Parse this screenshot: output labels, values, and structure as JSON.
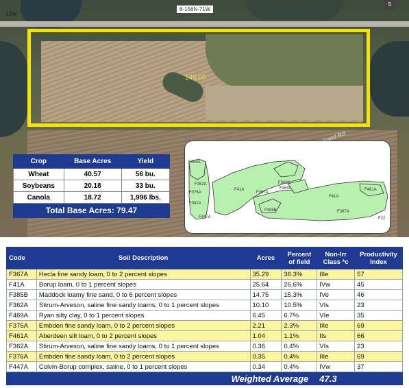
{
  "aerial": {
    "road_label": "6-156N-71W",
    "corner_label": "32W",
    "section_number": "5",
    "acre_label": "149.00",
    "side_road_label": "Sand Rd"
  },
  "crop_table": {
    "headers": [
      "Crop",
      "Base Acres",
      "Yield"
    ],
    "rows": [
      {
        "crop": "Wheat",
        "acres": "40.57",
        "yield": "56 bu."
      },
      {
        "crop": "Soybeans",
        "acres": "20.18",
        "yield": "33 bu."
      },
      {
        "crop": "Canola",
        "acres": "18.72",
        "yield": "1,996 lbs."
      }
    ],
    "total": "Total Base Acres: 79.47"
  },
  "soil_map": {
    "labels": [
      "F469A",
      "F362A",
      "F376A",
      "F362A",
      "F447A",
      "F41A",
      "F367A",
      "F362A",
      "F469A",
      "F385B",
      "F41A",
      "F461A",
      "F367A",
      "F22"
    ]
  },
  "soil_table": {
    "headers": {
      "code": "Code",
      "desc": "Soil Description",
      "acres": "Acres",
      "pct_line1": "Percent",
      "pct_line2": "of field",
      "class_line1": "Non-Irr",
      "class_line2": "Class *c",
      "prod_line1": "Productivity",
      "prod_line2": "Index"
    },
    "rows": [
      {
        "code": "F367A",
        "desc": "Hecla fine sandy loam, 0 to 2 percent slopes",
        "acres": "35.29",
        "pct": "36.3%",
        "class": "IIIe",
        "index": "57",
        "highlight": true
      },
      {
        "code": "F41A",
        "desc": "Borup loam, 0 to 1 percent slopes",
        "acres": "25.64",
        "pct": "26.6%",
        "class": "IVw",
        "index": "45",
        "highlight": false
      },
      {
        "code": "F385B",
        "desc": "Maddock loamy fine sand, 0 to 6 percent slopes",
        "acres": "14.75",
        "pct": "15.3%",
        "class": "IVe",
        "index": "46",
        "highlight": false
      },
      {
        "code": "F362A",
        "desc": "Stirum-Arveson, saline fine sandy loams, 0 to 1 percent slopes",
        "acres": "10.10",
        "pct": "10.5%",
        "class": "VIs",
        "index": "23",
        "highlight": false
      },
      {
        "code": "F469A",
        "desc": "Ryan silty clay, 0 to 1 percent slopes",
        "acres": "6.45",
        "pct": "6.7%",
        "class": "VIe",
        "index": "35",
        "highlight": false
      },
      {
        "code": "F376A",
        "desc": "Embden fine sandy loam, 0 to 2 percent slopes",
        "acres": "2.21",
        "pct": "2.3%",
        "class": "IIIe",
        "index": "69",
        "highlight": true
      },
      {
        "code": "F461A",
        "desc": "Aberdeen silt loam, 0 to 2 percent slopes",
        "acres": "1.04",
        "pct": "1.1%",
        "class": "IIs",
        "index": "66",
        "highlight": true
      },
      {
        "code": "F362A",
        "desc": "Stirum-Arveson, saline fine sandy loams, 0 to 1 percent slopes",
        "acres": "0.36",
        "pct": "0.4%",
        "class": "VIs",
        "index": "23",
        "highlight": false
      },
      {
        "code": "F376A",
        "desc": "Embden fine sandy loam, 0 to 2 percent slopes",
        "acres": "0.35",
        "pct": "0.4%",
        "class": "IIIe",
        "index": "69",
        "highlight": true
      },
      {
        "code": "F447A",
        "desc": "Colvin-Borup complex, saline, 0 to 1 percent slopes",
        "acres": "0.34",
        "pct": "0.4%",
        "class": "IVw",
        "index": "37",
        "highlight": false
      }
    ],
    "weighted_average_label": "Weighted Average",
    "weighted_average_value": "47.3"
  },
  "colors": {
    "header_blue": "#1f3a93",
    "highlight_yellow": "#fbf59f",
    "field_outline": "#f5e400",
    "soil_green": "#b8f0b0"
  }
}
